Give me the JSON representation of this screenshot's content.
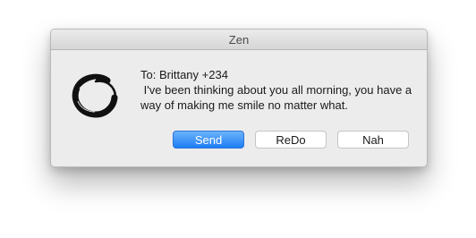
{
  "window": {
    "title": "Zen"
  },
  "icon": {
    "name": "enso-circle-icon"
  },
  "message": {
    "to": "To: Brittany +234",
    "body": " I've been thinking about you all morning, you have a way of making me smile no matter what."
  },
  "buttons": {
    "send_label": "Send",
    "redo_label": "ReDo",
    "nah_label": "Nah"
  },
  "colors": {
    "accent": "#1d7df4",
    "window_bg": "#ececec"
  }
}
